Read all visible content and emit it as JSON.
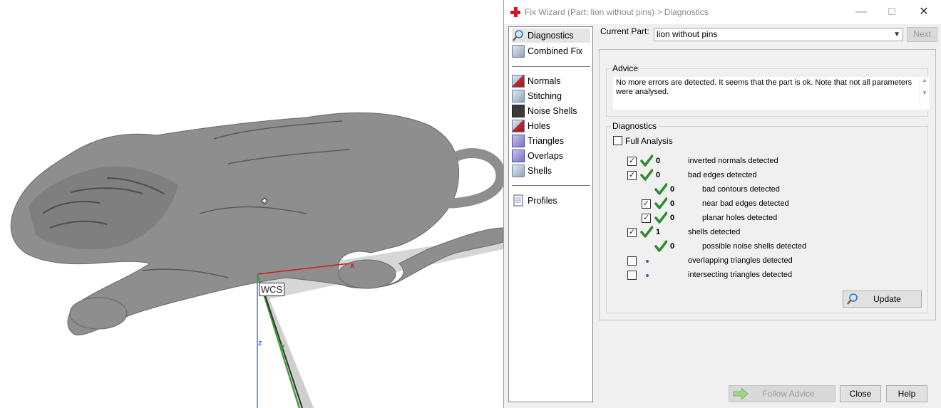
{
  "dialog": {
    "title": "Fix Wizard (Part: lion without pins) > Diagnostics",
    "window_controls": {
      "minimize": "—",
      "maximize": "☐",
      "close": "✕"
    }
  },
  "nav": {
    "items": [
      {
        "label": "Diagnostics",
        "icon": "magnifier-icon",
        "selected": true
      },
      {
        "label": "Combined Fix",
        "icon": "cube-icon"
      },
      {
        "label": "Normals",
        "icon": "normals-icon"
      },
      {
        "label": "Stitching",
        "icon": "stitching-icon"
      },
      {
        "label": "Noise Shells",
        "icon": "noise-shells-icon"
      },
      {
        "label": "Holes",
        "icon": "holes-icon"
      },
      {
        "label": "Triangles",
        "icon": "triangles-icon"
      },
      {
        "label": "Overlaps",
        "icon": "overlaps-icon"
      },
      {
        "label": "Shells",
        "icon": "shells-icon"
      },
      {
        "label": "Profiles",
        "icon": "profiles-icon"
      }
    ]
  },
  "current_part": {
    "label": "Current Part:",
    "value": "lion without pins"
  },
  "buttons": {
    "next": "Next",
    "update": "Update",
    "follow_advice": "Follow Advice",
    "close": "Close",
    "help": "Help"
  },
  "advice": {
    "title": "Advice",
    "text": "No more errors are detected. It seems that the part is ok. Note that not all parameters were analysed."
  },
  "diagnostics": {
    "title": "Diagnostics",
    "full_analysis": {
      "label": "Full Analysis",
      "checked": false
    },
    "rows": [
      {
        "label": "inverted normals detected",
        "count": "0",
        "checked": true,
        "ok": true,
        "indent": 0
      },
      {
        "label": "bad edges detected",
        "count": "0",
        "checked": true,
        "ok": true,
        "indent": 0
      },
      {
        "label": "bad contours detected",
        "count": "0",
        "checked": null,
        "ok": true,
        "indent": 1
      },
      {
        "label": "near bad edges detected",
        "count": "0",
        "checked": true,
        "ok": true,
        "indent": 1
      },
      {
        "label": "planar holes detected",
        "count": "0",
        "checked": true,
        "ok": true,
        "indent": 1
      },
      {
        "label": "shells detected",
        "count": "1",
        "checked": true,
        "ok": true,
        "indent": 0
      },
      {
        "label": "possible noise shells detected",
        "count": "0",
        "checked": null,
        "ok": true,
        "indent": 1
      },
      {
        "label": "overlapping triangles detected",
        "count": "",
        "checked": false,
        "ok": false,
        "indent": 0
      },
      {
        "label": "intersecting triangles detected",
        "count": "",
        "checked": false,
        "ok": false,
        "indent": 0
      }
    ]
  },
  "viewport": {
    "wcs_label": "WCS",
    "axes": {
      "x": "x",
      "y": "y",
      "z": "z"
    },
    "axis_colors": {
      "x": "#d11a1a",
      "y": "#2aa42a",
      "z": "#3c78d8"
    }
  },
  "colors": {
    "check_green": "#2e8b2e",
    "model_gray": "#8e8e8e"
  }
}
